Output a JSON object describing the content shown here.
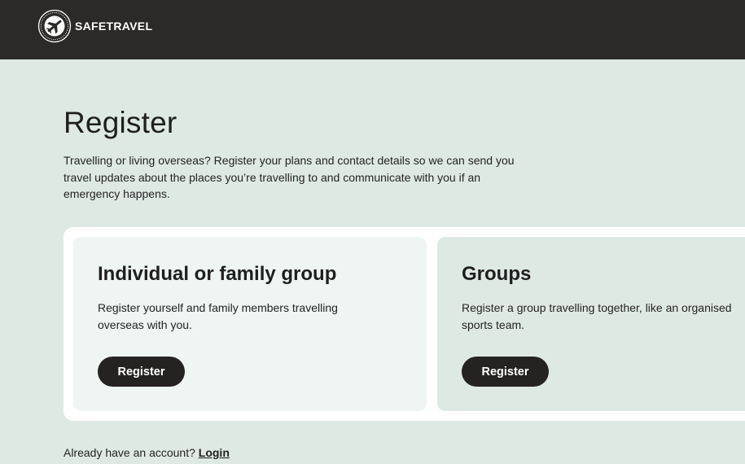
{
  "header": {
    "brand_name": "SAFETRAVEL",
    "logo_icon": "airplane-seal-icon",
    "background": "#2b2a29"
  },
  "page": {
    "title": "Register",
    "intro": "Travelling or living overseas? Register your plans and contact details so we can send you travel updates about the places you’re travelling to and communicate with you if an emergency happens.",
    "background": "#dfe9e4"
  },
  "cards": [
    {
      "title": "Individual or family group",
      "description_line1": "Register yourself and family members travelling",
      "description_line2": "overseas with you.",
      "button_label": "Register",
      "background": "#eef5f2"
    },
    {
      "title": "Groups",
      "description_line1": "Register a group travelling together, like an organised",
      "description_line2": "sports team.",
      "button_label": "Register",
      "background": "#dfe9e4"
    }
  ],
  "footer": {
    "account_prompt": "Already have an account? ",
    "login_label": "Login"
  },
  "colors": {
    "button": "#242322",
    "button_text": "#ffffff"
  }
}
